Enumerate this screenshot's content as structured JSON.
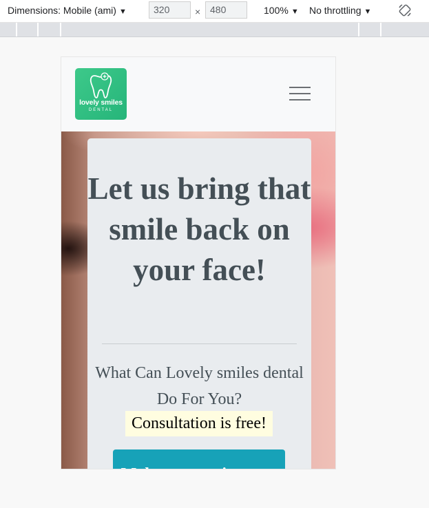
{
  "devtools": {
    "dimensions_label": "Dimensions: Mobile (ami)",
    "width_value": "320",
    "times_symbol": "×",
    "height_value": "480",
    "zoom_label": "100%",
    "throttling_label": "No throttling",
    "caret": "▼",
    "icons": {
      "rotate": "rotate-icon",
      "caret": "chevron-down-icon"
    }
  },
  "navbar": {
    "logo": {
      "name": "lovely smiles",
      "sub": "DENTAL",
      "icon": "tooth-icon"
    },
    "menu_icon": "hamburger-icon"
  },
  "hero": {
    "headline": "Let us bring that smile back on your face!",
    "subtitle": "What Can Lovely smiles dental Do For You?",
    "highlight": "Consultation is free!",
    "cta_label": "Make an appointment"
  },
  "colors": {
    "logo_green": "#2fbf80",
    "card_bg": "#e9ecef",
    "text_gray": "#444f56",
    "highlight_bg": "#fffde0",
    "cta_teal": "#17a2b8"
  }
}
